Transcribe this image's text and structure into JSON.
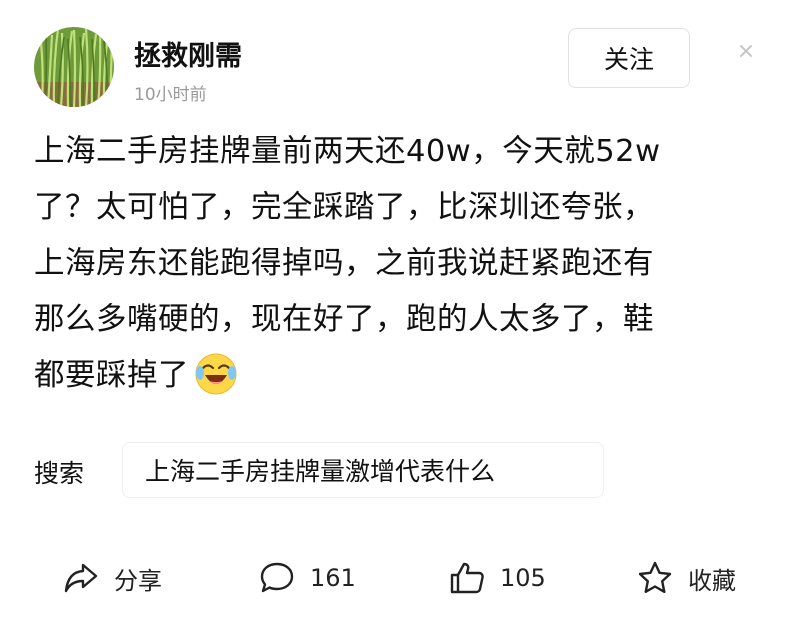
{
  "post": {
    "author": "拯救刚需",
    "time": "10小时前",
    "follow_label": "关注",
    "lines": [
      "上海二手房挂牌量前两天还40w，今天就52w",
      "了？太可怕了，完全踩踏了，比深圳还夸张，",
      "上海房东还能跑得掉吗，之前我说赶紧跑还有",
      "那么多嘴硬的，现在好了，跑的人太多了，鞋",
      "都要踩掉了"
    ],
    "emoji": "laughing-crying-emoji"
  },
  "search": {
    "label": "搜索",
    "query": "上海二手房挂牌量激增代表什么"
  },
  "actions": {
    "share_label": "分享",
    "comment_count": "161",
    "like_count": "105",
    "favorite_label": "收藏"
  },
  "colors": {
    "text": "#111111",
    "muted": "#9a9a9a",
    "border": "#e1e1e1"
  },
  "icons": [
    "avatar-grass-image",
    "close-icon",
    "share-icon",
    "comment-icon",
    "like-icon",
    "star-icon"
  ]
}
